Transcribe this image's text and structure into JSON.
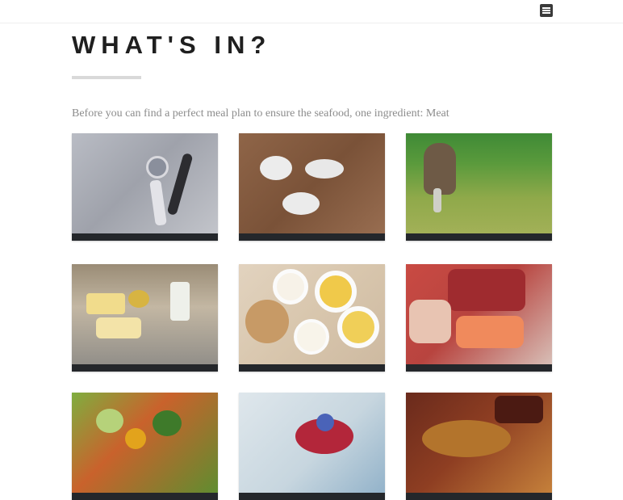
{
  "header": {
    "menu_icon": "hamburger-menu-icon",
    "title": "WHAT'S IN?"
  },
  "intro_text": "Before you can find a perfect meal plan to ensure the seafood, one ingredient: Meat",
  "accent_colors": {
    "title": "#1f1f1f",
    "rule": "#d9d9d9",
    "caption_bar": "#24272b",
    "intro": "#8c8c8c"
  },
  "grid": {
    "tiles": [
      {
        "photo": "knife-and-fork-on-stone",
        "caption": ""
      },
      {
        "photo": "name-card-stones-on-wood",
        "caption": ""
      },
      {
        "photo": "horse-in-meadow",
        "caption": ""
      },
      {
        "photo": "dairy-butter-cheese-milk",
        "caption": ""
      },
      {
        "photo": "eggs-and-flour-bowls",
        "caption": ""
      },
      {
        "photo": "raw-meat-and-salmon",
        "caption": ""
      },
      {
        "photo": "fresh-vegetables",
        "caption": ""
      },
      {
        "photo": "berries-in-bowl",
        "caption": ""
      },
      {
        "photo": "nuts-in-wooden-bowl",
        "caption": ""
      }
    ]
  }
}
